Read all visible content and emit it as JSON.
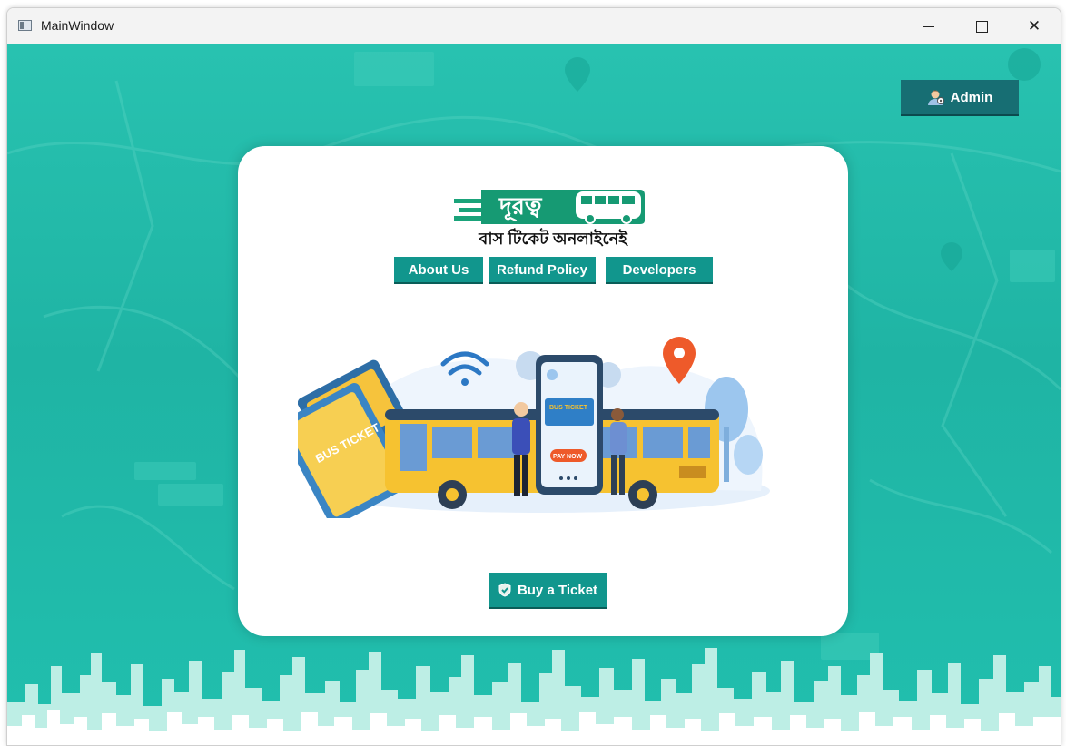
{
  "window": {
    "title": "MainWindow",
    "minimize_symbol": "—",
    "maximize_symbol": "☐",
    "close_symbol": "✕"
  },
  "header": {
    "admin_label": "Admin",
    "admin_icon": "admin-user-icon"
  },
  "card": {
    "logo_text": "দূরত্ব",
    "tagline": "বাস টিকেট অনলাইনেই",
    "nav": [
      {
        "label": "About Us"
      },
      {
        "label": "Refund Policy"
      },
      {
        "label": "Developers"
      }
    ],
    "illustration": {
      "ticket_label": "BUS TICKET",
      "pay_label": "PAY NOW"
    },
    "buy_label": "Buy a Ticket",
    "buy_icon": "shield-check-icon"
  },
  "colors": {
    "accent": "#11968d",
    "admin_bg": "#176e73",
    "background": "#21bfae",
    "card": "#ffffff"
  }
}
